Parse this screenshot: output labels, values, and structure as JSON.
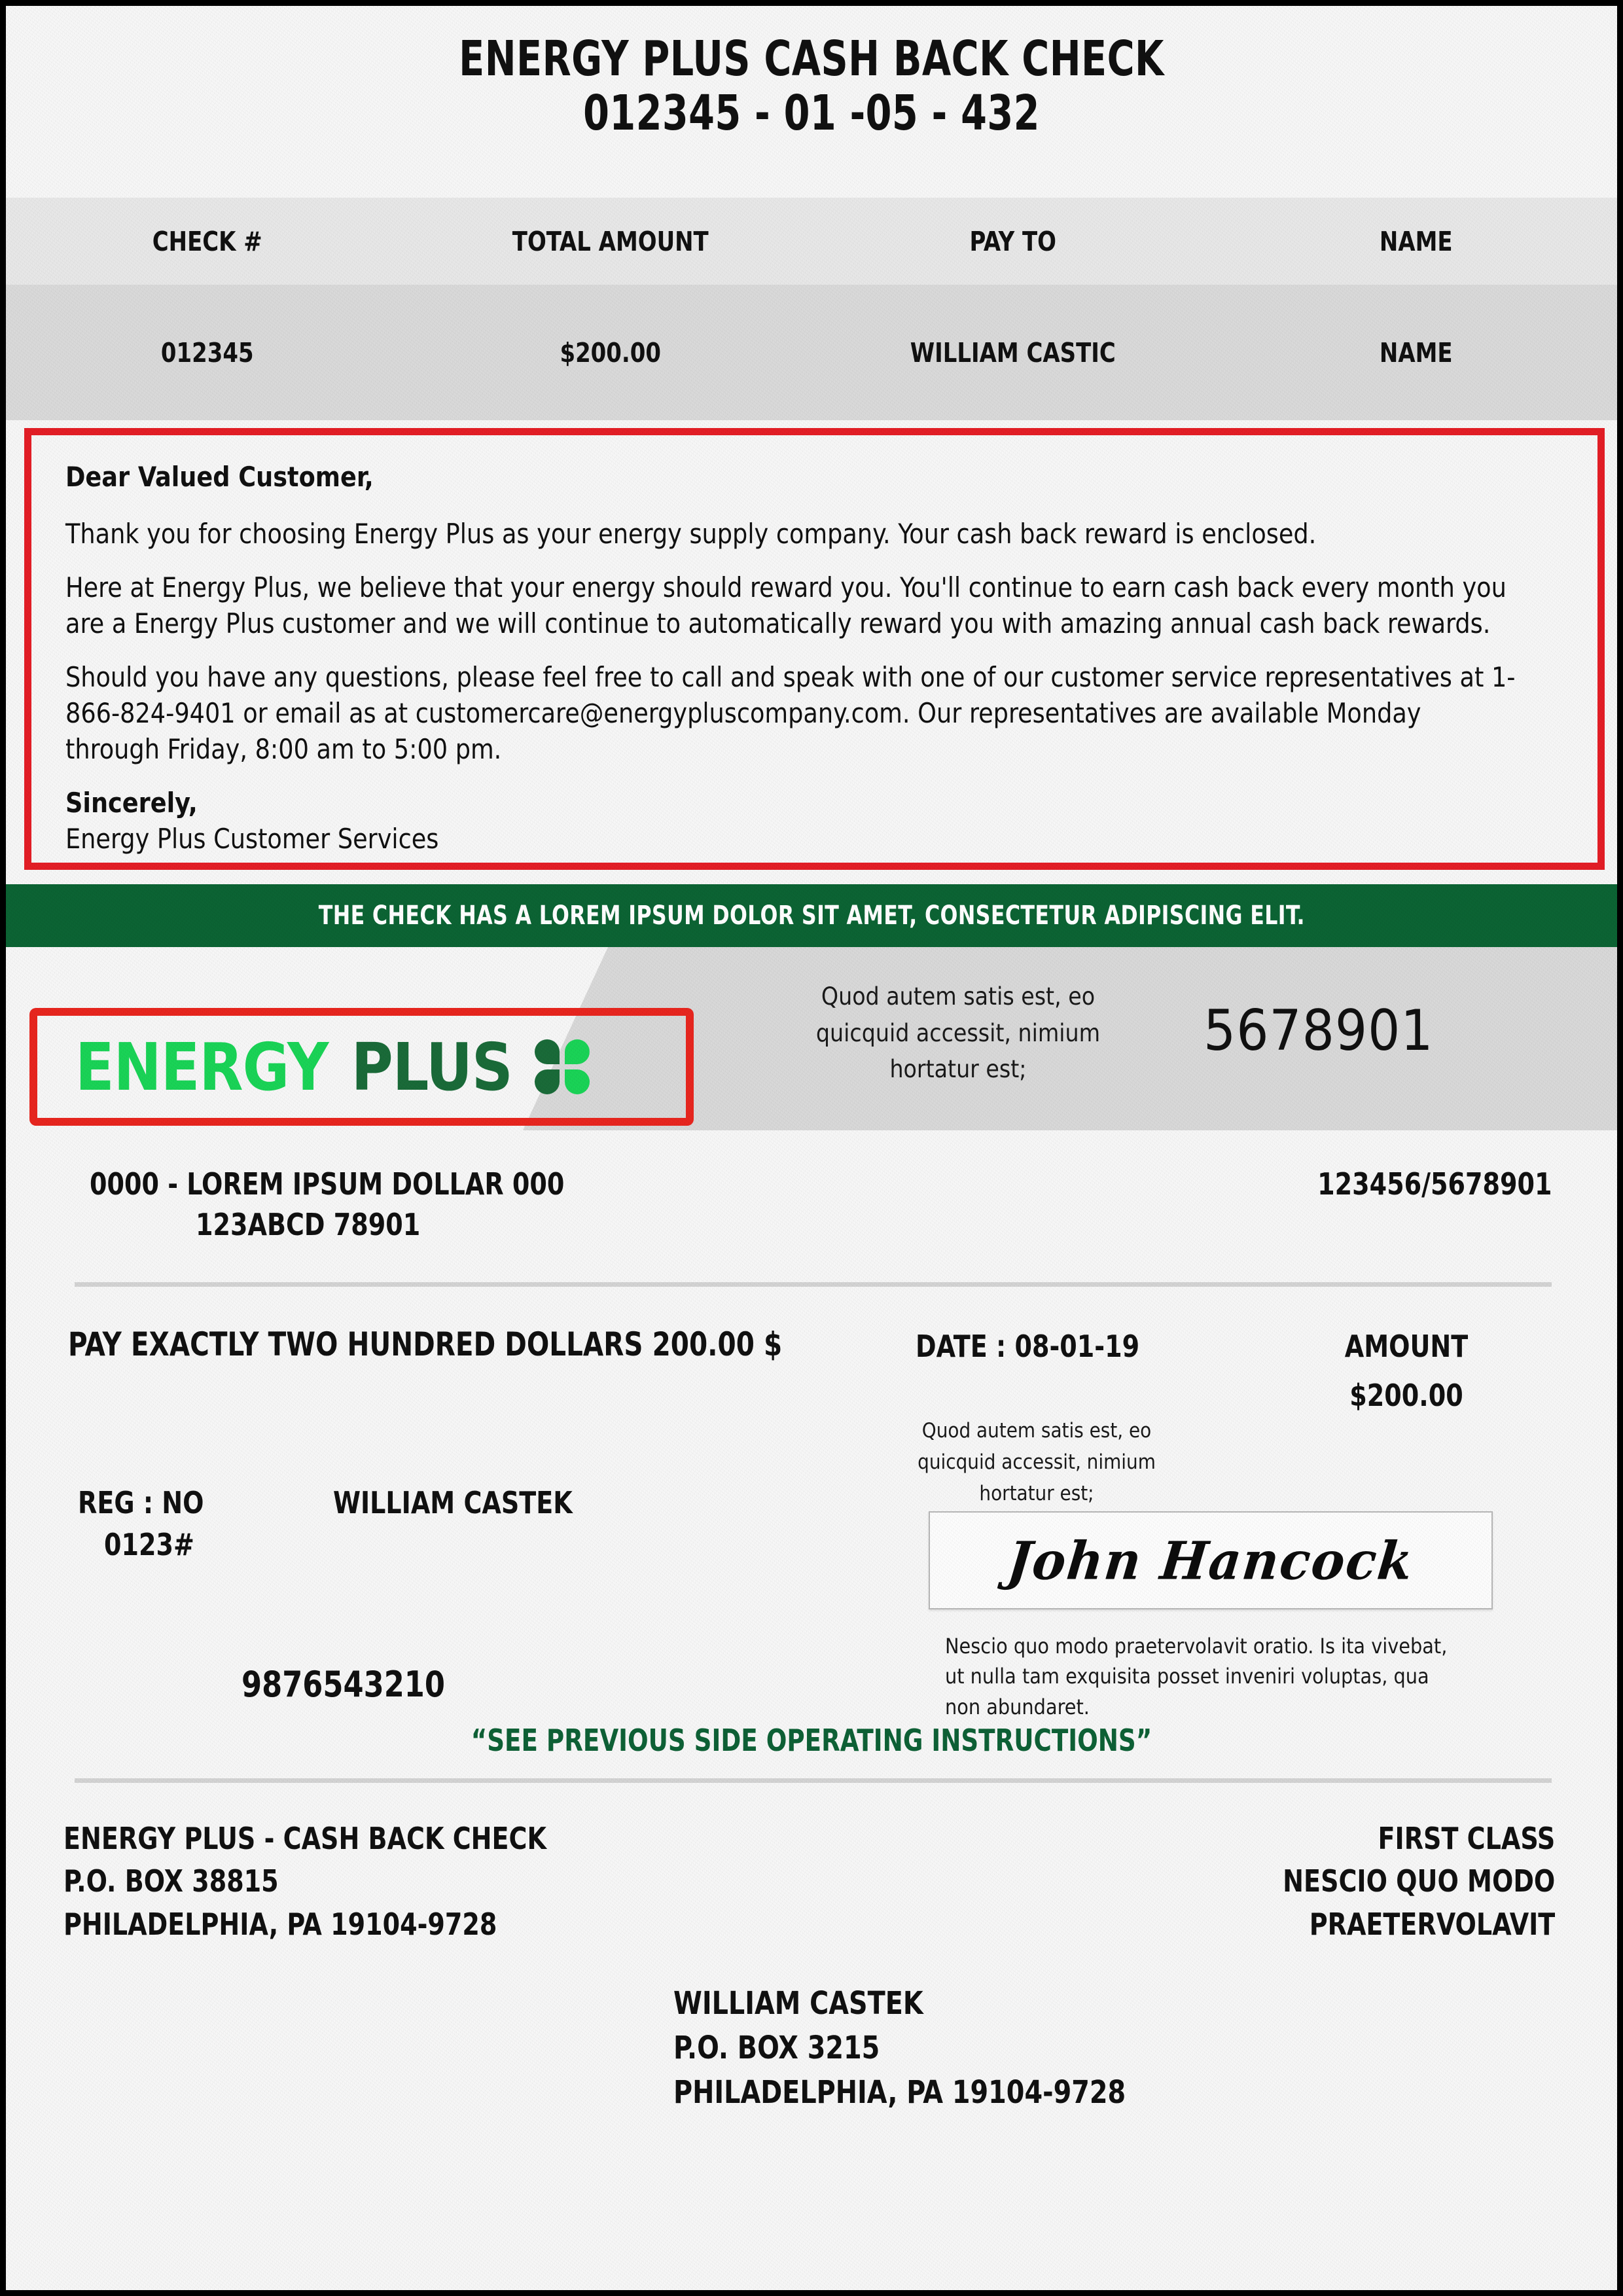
{
  "header": {
    "title": "ENERGY PLUS CASH BACK CHECK",
    "reference": "012345 - 01 -05 - 432"
  },
  "summary_table": {
    "columns": [
      "CHECK #",
      "TOTAL AMOUNT",
      "PAY TO",
      "NAME"
    ],
    "row": [
      "012345",
      "$200.00",
      "WILLIAM CASTIC",
      "NAME"
    ]
  },
  "letter": {
    "salutation": "Dear Valued Customer,",
    "paragraph_1": "Thank you for choosing Energy Plus as your energy supply company. Your cash back reward is enclosed.",
    "paragraph_2": "Here at Energy Plus, we believe that your energy should reward you. You'll continue to earn cash back every month you are a Energy Plus customer and we will continue to automatically reward you with amazing annual cash back rewards.",
    "paragraph_3": "Should you have any questions, please feel free to call and speak with one of our customer service representatives at 1-866-824-9401 or email as at customercare@energypluscompany.com. Our representatives are available Monday through Friday, 8:00 am to 5:00 pm.",
    "closing": "Sincerely,",
    "signer": "Energy Plus Customer Services",
    "border_color": "#e41e26"
  },
  "banner": {
    "text": "THE CHECK HAS A LOREM IPSUM DOLOR SIT AMET, CONSECTETUR ADIPISCING ELIT.",
    "background_color": "#0c6434",
    "text_color": "#ffffff"
  },
  "check": {
    "logo": {
      "word_1": "ENERGY",
      "word_2": "PLUS",
      "word_1_color": "#1ad457",
      "word_2_color": "#1a6b39",
      "box_border_color": "#e8261f"
    },
    "band_lorem": "Quod autem satis est, eo quicquid accessit, nimium hortatur est;",
    "check_number": "5678901",
    "account_line_1": "0000 - LOREM IPSUM DOLLAR 000",
    "account_line_2": "123ABCD 78901",
    "routing": "123456/5678901",
    "pay_line": "PAY EXACTLY TWO HUNDRED DOLLARS 200.00 $",
    "date_line": "DATE : 08-01-19",
    "amount_label": "AMOUNT",
    "amount_value": "$200.00",
    "middle_lorem": "Quod autem satis est, eo quicquid accessit, nimium hortatur est;",
    "reg_label": "REG : NO",
    "reg_value": "0123#",
    "payee_name": "WILLIAM CASTEK",
    "account_number": "9876543210",
    "signature": "John Hancock",
    "signature_note": "Nescio quo modo praetervolavit oratio. Is ita vivebat, ut nulla tam exquisita posset inveniri voluptas, qua non abundaret.",
    "see_previous": "“SEE PREVIOUS SIDE OPERATING INSTRUCTIONS”",
    "see_previous_color": "#0e6136"
  },
  "footer": {
    "issuer_address": "ENERGY PLUS - CASH BACK CHECK\nP.O. BOX 38815\nPHILADELPHIA, PA 19104-9728",
    "mail_class": "FIRST CLASS\nNESCIO QUO MODO\nPRAETERVOLAVIT",
    "recipient_address": "WILLIAM CASTEK\nP.O. BOX 3215\nPHILADELPHIA, PA 19104-9728"
  }
}
